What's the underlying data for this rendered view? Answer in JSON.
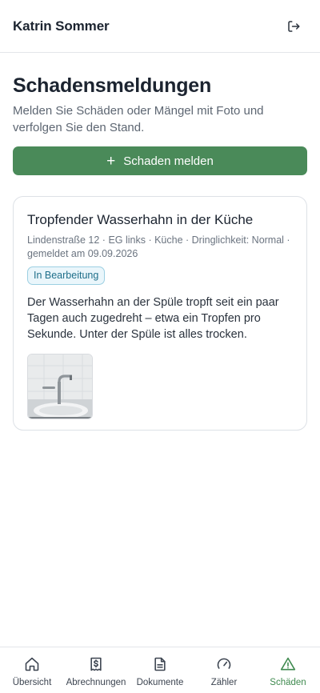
{
  "header": {
    "user_name": "Katrin Sommer",
    "logout_icon": "logout-icon"
  },
  "page": {
    "title": "Schadensmeldungen",
    "subtitle": "Melden Sie Schäden oder Mängel mit Foto und verfolgen Sie den Stand.",
    "report_button": "Schaden melden"
  },
  "reports": [
    {
      "title": "Tropfender Wasserhahn in der Küche",
      "meta": "Lindenstraße 12 · EG links · Küche · Dringlichkeit: Normal · gemeldet am 09.09.2026",
      "status": "In Bearbeitung",
      "description": "Der Wasserhahn an der Spüle tropft seit ein paar Tagen auch zugedreht – etwa ein Tropfen pro Sekunde. Unter der Spüle ist alles trocken."
    }
  ],
  "nav": [
    {
      "label": "Übersicht",
      "icon": "home-icon"
    },
    {
      "label": "Abrechnungen",
      "icon": "receipt-icon"
    },
    {
      "label": "Dokumente",
      "icon": "document-icon"
    },
    {
      "label": "Zähler",
      "icon": "gauge-icon"
    },
    {
      "label": "Schäden",
      "icon": "warning-icon",
      "active": true
    }
  ],
  "colors": {
    "accent": "#4a8a59",
    "active_nav": "#3f8a4f",
    "badge": "#1f6f8a"
  }
}
